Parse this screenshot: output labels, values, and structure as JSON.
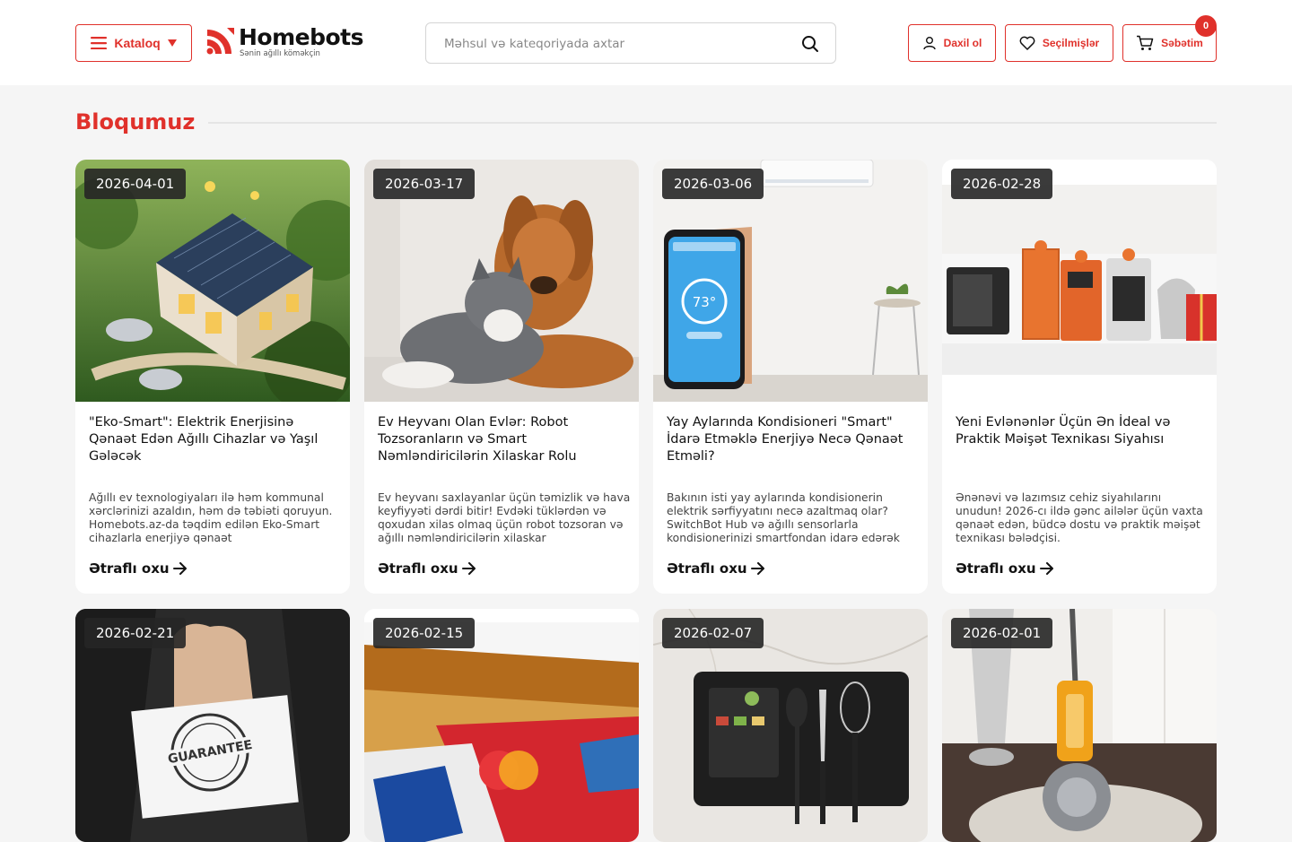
{
  "header": {
    "catalog_label": "Kataloq",
    "brand_name": "Homebots",
    "brand_tagline": "Sənin ağıllı köməkçin",
    "search_placeholder": "Məhsul və kateqoriyada axtar",
    "login_label": "Daxil ol",
    "favorites_label": "Seçilmişlər",
    "cart_label": "Səbətim",
    "cart_count": "0"
  },
  "colors": {
    "accent": "#e0312b",
    "page_bg": "#f5f5f5",
    "date_badge_bg": "#262626"
  },
  "section": {
    "title": "Bloqumuz"
  },
  "read_more_label": "Ətraflı oxu",
  "posts": [
    {
      "date": "2026-04-01",
      "image": "smart-eco-house-with-solar-panels",
      "title": "\"Eko-Smart\": Elektrik Enerjisinə Qənaət Edən Ağıllı Cihazlar və Yaşıl Gələcək",
      "excerpt": "Ağıllı ev texnologiyaları ilə həm kommunal xərclərinizi azaldın, həm də təbiəti qoruyun. Homebots.az-da təqdim edilən Eko-Smart cihazlarla enerjiyə qənaət"
    },
    {
      "date": "2026-03-17",
      "image": "golden-retriever-and-cat",
      "title": "Ev Heyvanı Olan Evlər: Robot Tozsoranların və Smart Nəmləndiricilərin Xilaskar Rolu",
      "excerpt": "Ev heyvanı saxlayanlar üçün təmizlik və hava keyfiyyəti dərdi bitir! Evdəki tüklərdən və qoxudan xilas olmaq üçün robot tozsoran və ağıllı nəmləndiricilərin xilaskar"
    },
    {
      "date": "2026-03-06",
      "image": "phone-controlling-air-conditioner",
      "title": "Yay Aylarında Kondisioneri \"Smart\" İdarə Etməklə Enerjiyə Necə Qənaət Etməli?",
      "excerpt": "Bakının isti yay aylarında kondisionerin elektrik sərfiyyatını necə azaltmaq olar? SwitchBot Hub və ağıllı sensorlarla kondisionerinizi smartfondan idarə edərək"
    },
    {
      "date": "2026-02-28",
      "image": "kitchen-appliances-with-gift-bows",
      "title": "Yeni Evlənənlər Üçün Ən İdeal və Praktik Məişət Texnikası Siyahısı",
      "excerpt": "Ənənəvi və lazımsız cehiz siyahılarını unudun! 2026-cı ildə gənc ailələr üçün vaxta qənaət edən, büdcə dostu və praktik məişət texnikası bələdçisi."
    },
    {
      "date": "2026-02-21",
      "image": "hand-holding-guarantee-card"
    },
    {
      "date": "2026-02-15",
      "image": "stack-of-credit-cards"
    },
    {
      "date": "2026-02-07",
      "image": "smart-kitchen-display-with-utensils"
    },
    {
      "date": "2026-02-01",
      "image": "cordless-vacuum-cleaner"
    }
  ]
}
